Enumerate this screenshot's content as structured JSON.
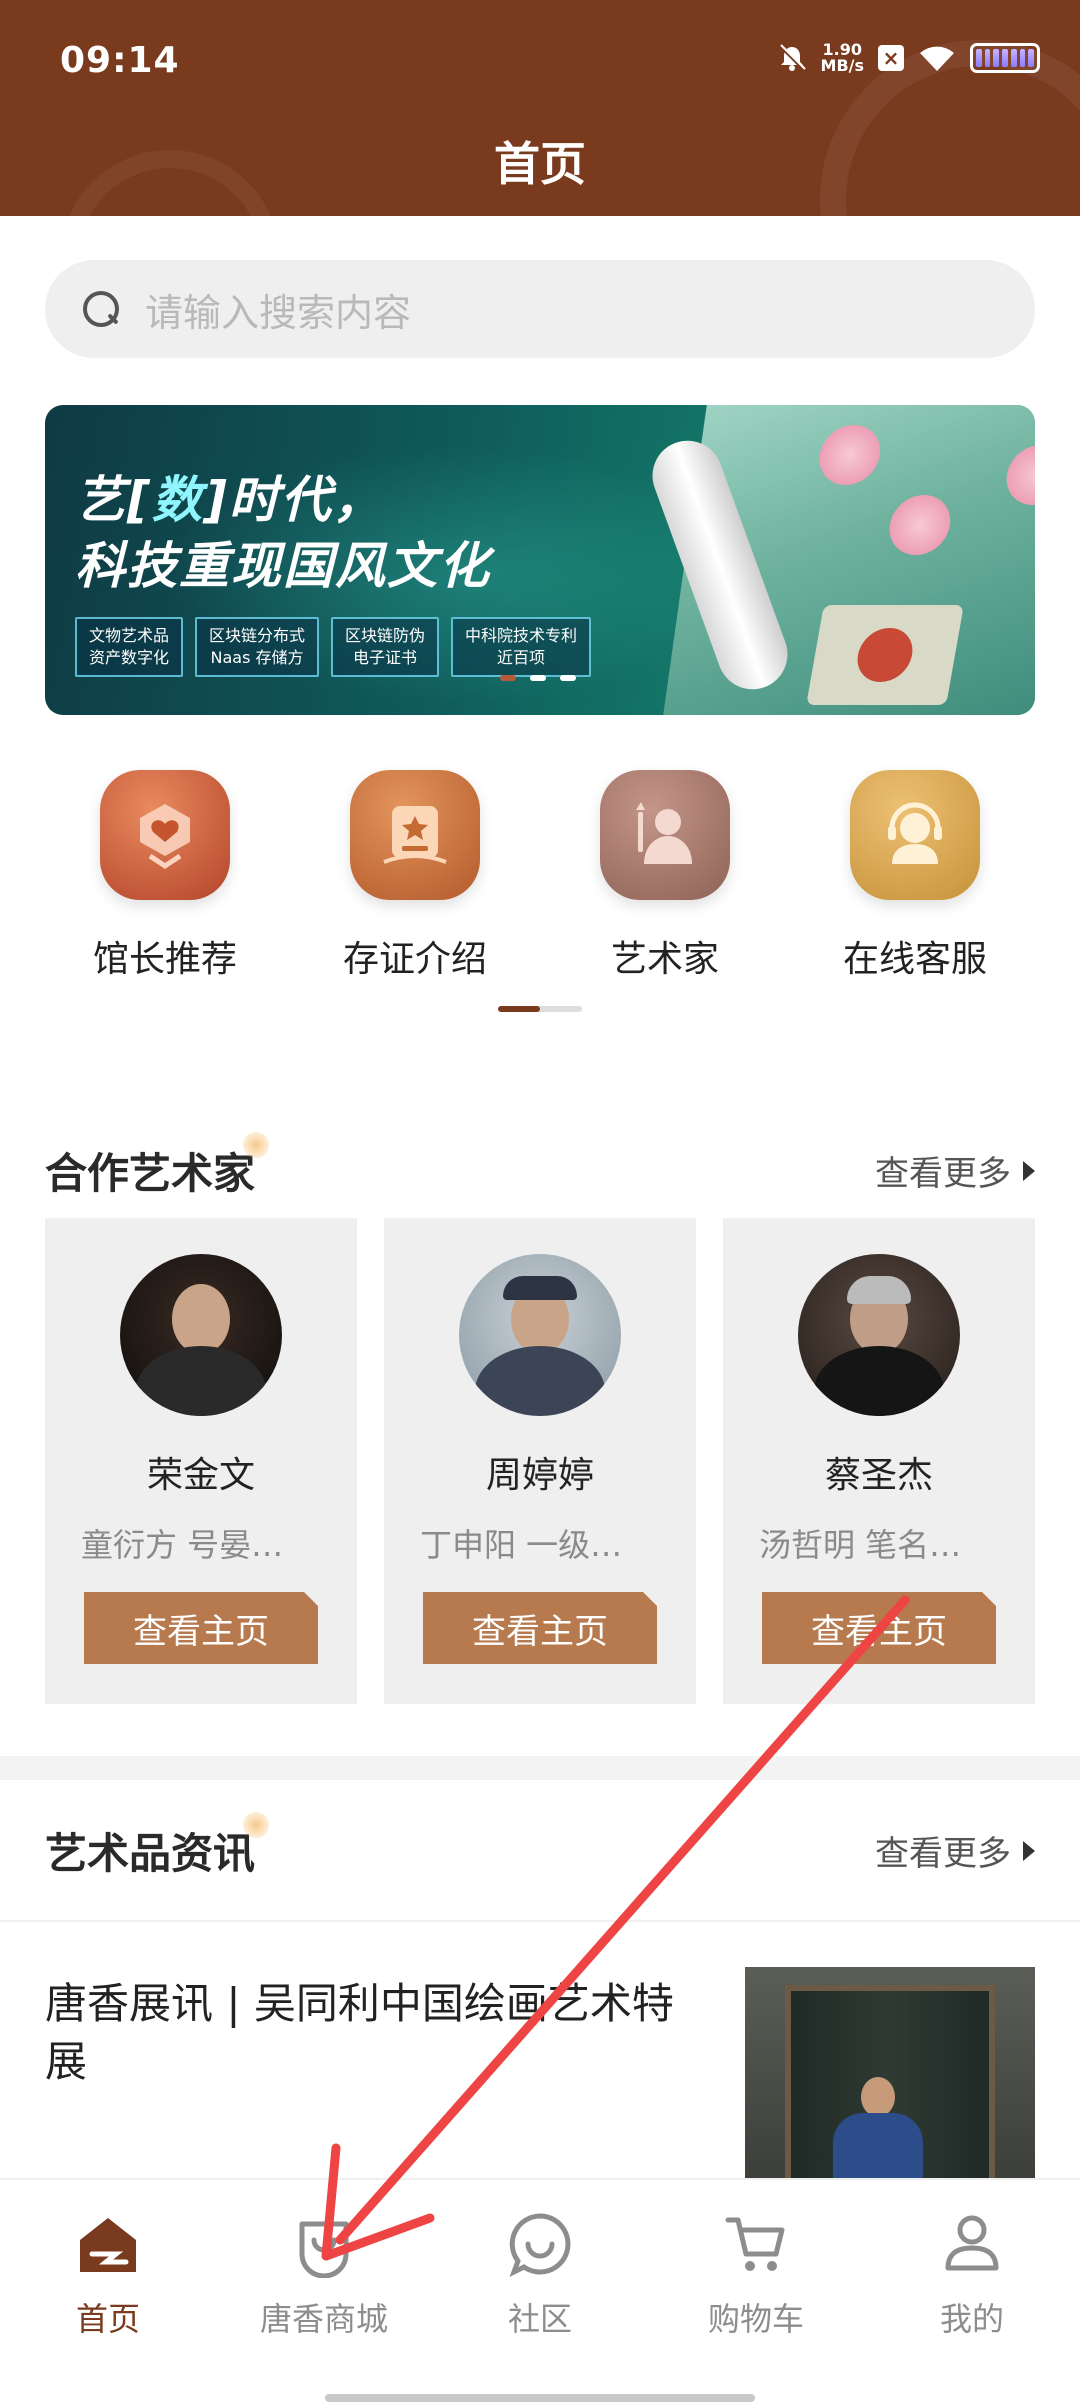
{
  "status_bar": {
    "time": "09:14",
    "speed_value": "1.90",
    "speed_unit": "MB/s",
    "icons": [
      "mute-bell-icon",
      "close-box-icon",
      "wifi-icon",
      "battery-icon"
    ]
  },
  "header": {
    "title": "首页",
    "bg_color": "#7a3a1e"
  },
  "search": {
    "placeholder": "请输入搜索内容",
    "icon": "search-icon"
  },
  "banner": {
    "title_line1_pre": "艺[",
    "title_line1_big": "数",
    "title_line1_post": "]时代，",
    "title_line2": "科技重现国风文化",
    "tags": [
      {
        "line1": "文物艺术品",
        "line2": "资产数字化"
      },
      {
        "line1": "区块链分布式",
        "line2": "Naas 存储方"
      },
      {
        "line1": "区块链防伪",
        "line2": "电子证书"
      },
      {
        "line1": "中科院技术专利",
        "line2": "近百项"
      }
    ],
    "dots": 3,
    "active_dot": 0
  },
  "quick_menu": [
    {
      "label": "馆长推荐",
      "icon": "curator-recommend-icon"
    },
    {
      "label": "存证介绍",
      "icon": "certificate-intro-icon"
    },
    {
      "label": "艺术家",
      "icon": "artist-icon"
    },
    {
      "label": "在线客服",
      "icon": "customer-service-icon"
    }
  ],
  "artists_section": {
    "title": "合作艺术家",
    "more": "查看更多",
    "items": [
      {
        "name": "荣金文",
        "desc": "童衍方 号晏…",
        "button": "查看主页"
      },
      {
        "name": "周婷婷",
        "desc": "丁申阳 一级…",
        "button": "查看主页"
      },
      {
        "name": "蔡圣杰",
        "desc": "汤哲明 笔名…",
        "button": "查看主页"
      }
    ]
  },
  "news_section": {
    "title": "艺术品资讯",
    "more": "查看更多",
    "items": [
      {
        "title": "唐香展讯 | 吴同利中国绘画艺术特展"
      }
    ]
  },
  "bottom_nav": [
    {
      "label": "首页",
      "icon": "home-icon",
      "active": true
    },
    {
      "label": "唐香商城",
      "icon": "shopping-bag-icon",
      "active": false
    },
    {
      "label": "社区",
      "icon": "community-icon",
      "active": false
    },
    {
      "label": "购物车",
      "icon": "cart-icon",
      "active": false
    },
    {
      "label": "我的",
      "icon": "profile-icon",
      "active": false
    }
  ],
  "colors": {
    "brand": "#7a3a1e",
    "button": "#b77a4e",
    "annotation_arrow": "#ee4444"
  }
}
